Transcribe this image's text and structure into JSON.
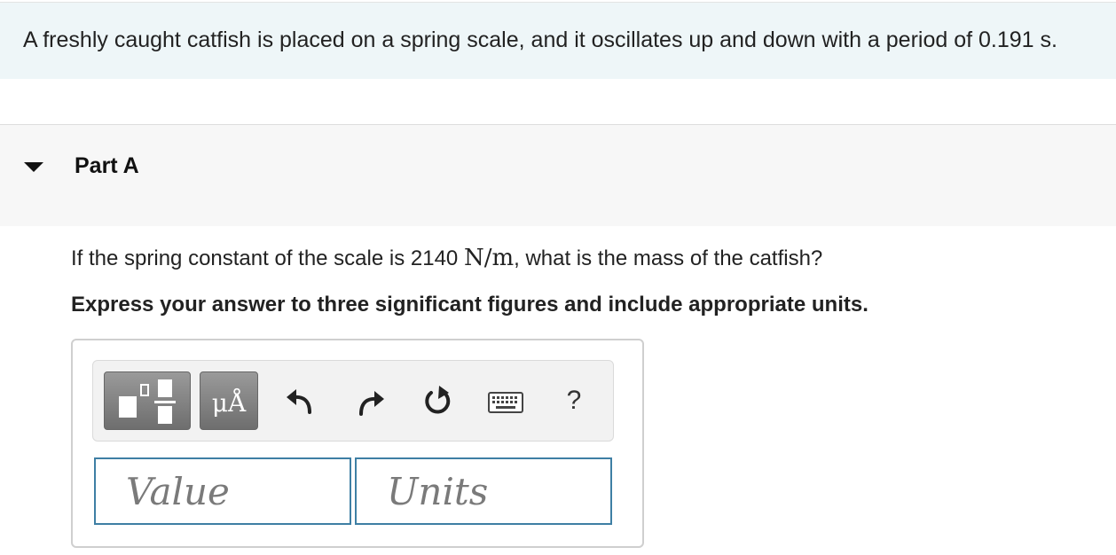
{
  "problem": {
    "text": "A freshly caught catfish is placed on a spring scale, and it oscillates up and down with a period of 0.191 s."
  },
  "part": {
    "title": "Part A",
    "question_prefix": "If the spring constant of the scale is 2140 ",
    "question_unit": "N/m",
    "question_suffix": ", what is the mass of the catfish?",
    "instruction": "Express your answer to three significant figures and include appropriate units."
  },
  "toolbar": {
    "templates_icon": "templates-icon",
    "units_label": "μÅ",
    "undo_icon": "undo-icon",
    "redo_icon": "redo-icon",
    "reset_icon": "reset-icon",
    "keyboard_icon": "keyboard-icon",
    "help_label": "?"
  },
  "answer": {
    "value_placeholder": "Value",
    "units_placeholder": "Units"
  }
}
